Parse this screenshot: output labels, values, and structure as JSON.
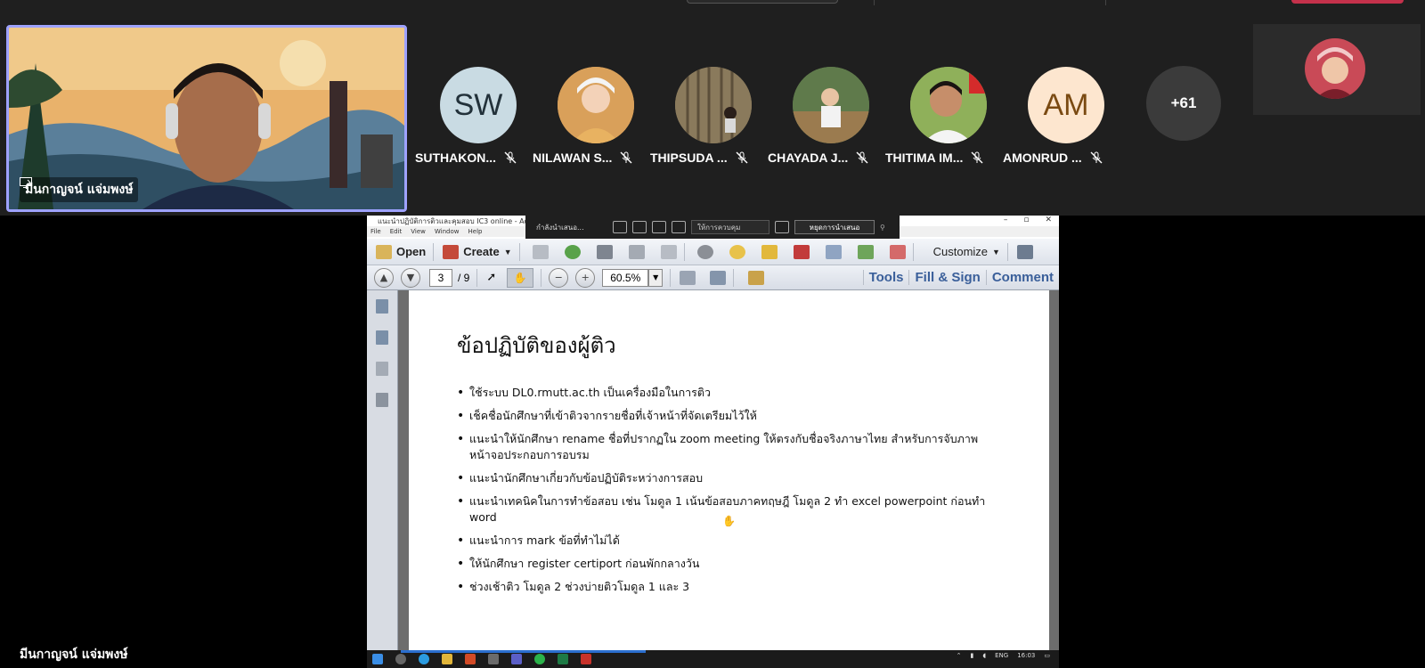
{
  "speaker": {
    "name": "มีนกาญจน์ แจ่มพงษ์"
  },
  "stage": {
    "name": "มีนกาญจน์ แจ่มพงษ์"
  },
  "participants": [
    {
      "name": "SUTHAKON...",
      "initials": "SW",
      "bg": "#c9dbe3",
      "fg": "#22313a"
    },
    {
      "name": "NILAWAN S...",
      "initials": "",
      "bg": "#d9a05a",
      "fg": "#ffffff"
    },
    {
      "name": "THIPSUDA ...",
      "initials": "",
      "bg": "#8a7a5c",
      "fg": "#ffffff"
    },
    {
      "name": "CHAYADA J...",
      "initials": "",
      "bg": "#5f7a4b",
      "fg": "#ffffff"
    },
    {
      "name": "THITIMA IM...",
      "initials": "",
      "bg": "#8fb05a",
      "fg": "#ffffff"
    },
    {
      "name": "AMONRUD ...",
      "initials": "AM",
      "bg": "#fde6cf",
      "fg": "#7a4a12"
    }
  ],
  "overflow_count": "+61",
  "acrobat": {
    "title": "แนะนำปฏิบัติการติวและคุมสอบ IC3 online - Adobe Acrobat",
    "menu": [
      "File",
      "Edit",
      "View",
      "Window",
      "Help"
    ],
    "presenting_label": "กำลังนำเสนอ...",
    "control_label": "ให้การควบคุม",
    "stop_label": "หยุดการนำเสนอ",
    "open_label": "Open",
    "create_label": "Create",
    "customize_label": "Customize",
    "page_current": "3",
    "page_total": "/ 9",
    "zoom": "60.5%",
    "tools_label": "Tools",
    "fillsign_label": "Fill & Sign",
    "comment_label": "Comment"
  },
  "document": {
    "title": "ข้อปฏิบัติของผู้ติว",
    "bullets": [
      "ใช้ระบบ DL0.rmutt.ac.th เป็นเครื่องมือในการติว",
      "เช็คชื่อนักศึกษาที่เข้าติวจากรายชื่อที่เจ้าหน้าที่จัดเตรียมไว้ให้",
      "แนะนำให้นักศึกษา rename ชื่อที่ปรากฏใน zoom meeting ให้ตรงกับชื่อจริงภาษาไทย สำหรับการจับภาพหน้าจอประกอบการอบรม",
      "แนะนำนักศึกษาเกี่ยวกับข้อปฏิบัติระหว่างการสอบ",
      "แนะนำเทคนิคในการทำข้อสอบ เช่น โมดูล 1 เน้นข้อสอบภาคทฤษฎี โมดูล 2 ทำ excel powerpoint ก่อนทำ word",
      "แนะนำการ mark ข้อที่ทำไม่ได้",
      "ให้นักศึกษา register certiport ก่อนพักกลางวัน",
      "ช่วงเช้าติว โมดูล 2 ช่วงบ่ายติวโมดูล 1 และ 3"
    ]
  },
  "taskbar": {
    "lang": "ENG",
    "time": "16:03"
  }
}
